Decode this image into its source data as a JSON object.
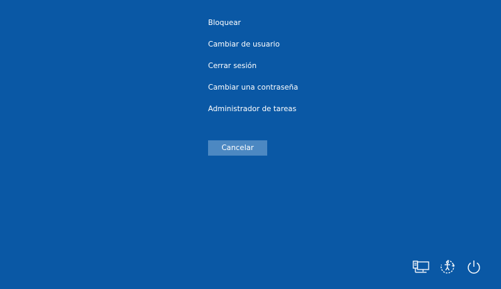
{
  "menu": {
    "items": [
      {
        "label": "Bloquear"
      },
      {
        "label": "Cambiar de usuario"
      },
      {
        "label": "Cerrar sesión"
      },
      {
        "label": "Cambiar una contraseña"
      },
      {
        "label": "Administrador de tareas"
      }
    ]
  },
  "cancel": {
    "label": "Cancelar"
  },
  "tray": {
    "icons": [
      "network-icon",
      "ease-of-access-icon",
      "power-icon"
    ]
  },
  "colors": {
    "background": "#0a58a5",
    "button": "#4c88c2",
    "text": "#ffffff"
  }
}
